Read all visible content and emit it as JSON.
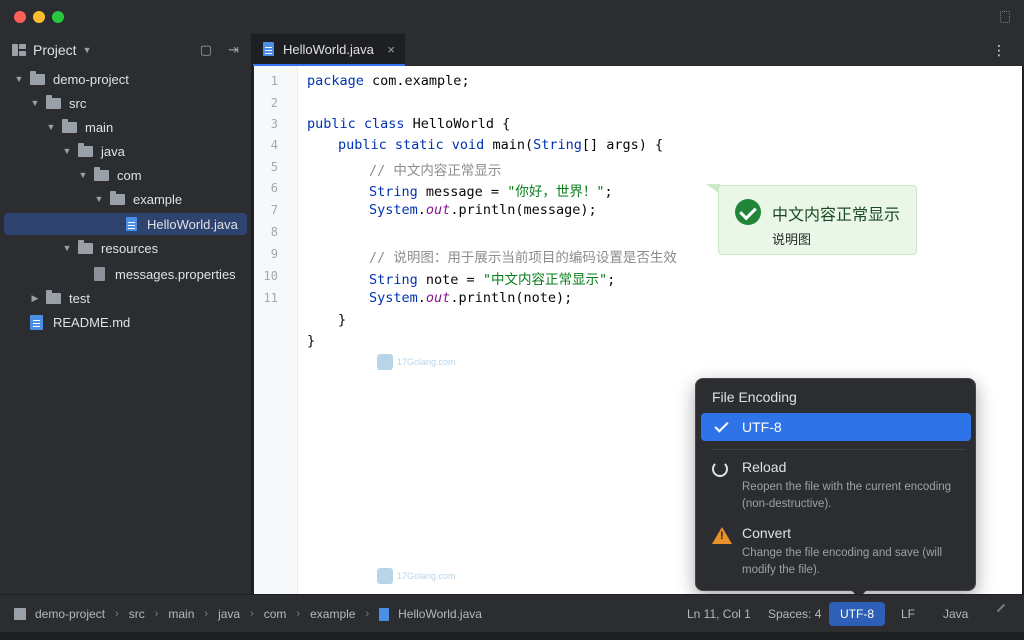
{
  "window": {
    "controls": [
      "close",
      "minimize",
      "zoom"
    ]
  },
  "sidebar": {
    "title": "Project",
    "tree": [
      {
        "label": "demo-project",
        "type": "folder",
        "depth": 0,
        "expanded": true
      },
      {
        "label": "src",
        "type": "folder",
        "depth": 1,
        "expanded": true
      },
      {
        "label": "main",
        "type": "folder",
        "depth": 2,
        "expanded": true
      },
      {
        "label": "java",
        "type": "folder",
        "depth": 3,
        "expanded": true
      },
      {
        "label": "com",
        "type": "folder",
        "depth": 4,
        "expanded": true
      },
      {
        "label": "example",
        "type": "folder",
        "depth": 5,
        "expanded": true
      },
      {
        "label": "HelloWorld.java",
        "type": "java",
        "depth": 6,
        "selected": true
      },
      {
        "label": "resources",
        "type": "folder",
        "depth": 3,
        "expanded": true
      },
      {
        "label": "messages.properties",
        "type": "properties",
        "depth": 4
      },
      {
        "label": "test",
        "type": "folder",
        "depth": 1,
        "expanded": false
      },
      {
        "label": "README.md",
        "type": "markdown",
        "depth": 0
      }
    ]
  },
  "editor": {
    "tab": {
      "label": "HelloWorld.java",
      "close": "×"
    },
    "menu_icon": "⋮",
    "line_numbers": [
      "1",
      "2",
      "3",
      "4",
      "5",
      "6",
      "7",
      "8",
      "9",
      "10",
      "11"
    ],
    "code": {
      "l1_kw": "package",
      "l1_rest": " com.example;",
      "l3_kw": "public class",
      "l3_rest": " HelloWorld {",
      "l4_kw": "public static void",
      "l4_mid": " main(",
      "l4_cls": "String",
      "l4_rest": "[] args) {",
      "l5_cm": "// 中文内容正常显示",
      "l6_cls": "String",
      "l6_mid": " message = ",
      "l6_str": "\"你好，世界！\"",
      "l6_end": ";",
      "l7_cls": "System",
      "l7_dot": ".",
      "l7_it": "out",
      "l7_rest": ".println(message);",
      "l9_cm": "// 说明图：用于展示当前项目的编码设置是否生效",
      "l10_cls": "String",
      "l10_mid": " note = ",
      "l10_str": "\"中文内容正常显示\"",
      "l10_end": ";",
      "l11_cls": "System",
      "l11_dot": ".",
      "l11_it": "out",
      "l11_rest": ".println(note);",
      "close_method": "}",
      "close_class": "}"
    }
  },
  "callout": {
    "title": "中文内容正常显示",
    "subtitle": "说明图",
    "icon": "check-circle-icon",
    "color": "#22863a"
  },
  "watermark": {
    "text": "17Golang.com"
  },
  "encoding_popup": {
    "title": "File Encoding",
    "selected": "UTF-8",
    "options": [
      {
        "label": "Reload",
        "description": "Reopen the file with the current encoding (non-destructive).",
        "icon": "reload-icon"
      },
      {
        "label": "Convert",
        "description": "Change the file encoding and save (will modify the file).",
        "icon": "warning-icon"
      }
    ]
  },
  "statusbar": {
    "breadcrumb": [
      "demo-project",
      "src",
      "main",
      "java",
      "com",
      "example",
      "HelloWorld.java"
    ],
    "position": "Ln 11, Col 1",
    "indent": "Spaces: 4",
    "encoding": "UTF-8",
    "line_separator": "LF",
    "language": "Java"
  },
  "colors": {
    "accent": "#3574f0",
    "selection": "#2e436e",
    "warning": "#e8912d"
  }
}
